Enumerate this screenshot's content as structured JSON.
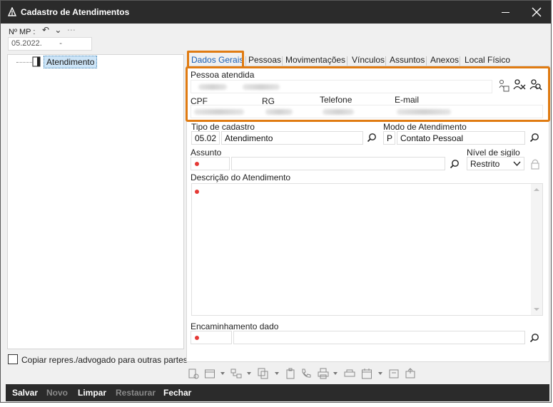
{
  "window": {
    "title": "Cadastro de Atendimentos"
  },
  "mp": {
    "label": "Nº MP :",
    "value": "05.2022.        -",
    "undo_symbol": "↶",
    "dropdown_symbol": "⌄",
    "more_symbol": "⋯"
  },
  "tree": {
    "node_label": "Atendimento"
  },
  "copy_option": {
    "label": "Copiar repres./advogado para outras partes"
  },
  "tabs": [
    {
      "label": "Dados Gerais",
      "active": true
    },
    {
      "label": "Pessoas"
    },
    {
      "label": "Movimentações"
    },
    {
      "label": "Vínculos"
    },
    {
      "label": "Assuntos"
    },
    {
      "label": "Anexos"
    },
    {
      "label": "Local Físico"
    }
  ],
  "pessoa": {
    "label": "Pessoa atendida",
    "cpf_label": "CPF",
    "rg_label": "RG",
    "telefone_label": "Telefone",
    "email_label": "E-mail"
  },
  "tipo_cadastro": {
    "label": "Tipo de cadastro",
    "code": "05.02",
    "value": "Atendimento"
  },
  "modo_atendimento": {
    "label": "Modo de Atendimento",
    "code": "P",
    "value": "Contato Pessoal"
  },
  "assunto": {
    "label": "Assunto"
  },
  "sigilo": {
    "label": "Nível de sigilo",
    "value": "Restrito"
  },
  "descricao": {
    "label": "Descrição do Atendimento"
  },
  "encaminhamento": {
    "label": "Encaminhamento dado"
  },
  "footer": {
    "salvar": "Salvar",
    "novo": "Novo",
    "limpar": "Limpar",
    "restaurar": "Restaurar",
    "fechar": "Fechar"
  },
  "colors": {
    "highlight": "#e07b12",
    "required": "#e53935",
    "titlebar": "#2b2b2b",
    "active_tab": "#1a5fb4"
  }
}
